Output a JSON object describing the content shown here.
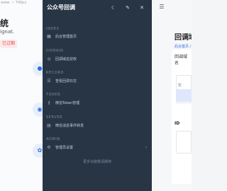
{
  "left_page": {
    "top_strip": "www. ~ T40px",
    "title": "统",
    "subtitle": "ignat.",
    "tag": "已过期"
  },
  "drawer": {
    "title": "公众号回调",
    "header_icons": [
      "moon-icon",
      "edit-icon",
      "close-icon"
    ],
    "sections": [
      {
        "label": "INDEX",
        "items": [
          {
            "icon": "grid-icon",
            "label": "后台管理首页"
          }
        ]
      },
      {
        "label": "DOMAIN",
        "items": [
          {
            "icon": "globe-icon",
            "label": "回调域名授权"
          }
        ]
      },
      {
        "label": "RECORD",
        "items": [
          {
            "icon": "list-icon",
            "label": "查看回调日志"
          }
        ]
      },
      {
        "label": "TOKEN",
        "items": [
          {
            "icon": "key-icon",
            "label": "微信Token管理"
          }
        ]
      },
      {
        "label": "SERVER",
        "items": [
          {
            "icon": "server-icon",
            "label": "微信消息事件转发"
          }
        ]
      },
      {
        "label": "ADMIN",
        "items": [
          {
            "icon": "gear-icon",
            "label": "管理员设置",
            "chevron": "‹"
          }
        ]
      }
    ],
    "footer": "更多功能敬请期待"
  },
  "right_page": {
    "menu_icon": "menu-icon",
    "title": "回调域",
    "breadcrumb": "后台首页 /",
    "field_label": "回调域名",
    "field_hint": "暂",
    "id_label": "ID"
  }
}
